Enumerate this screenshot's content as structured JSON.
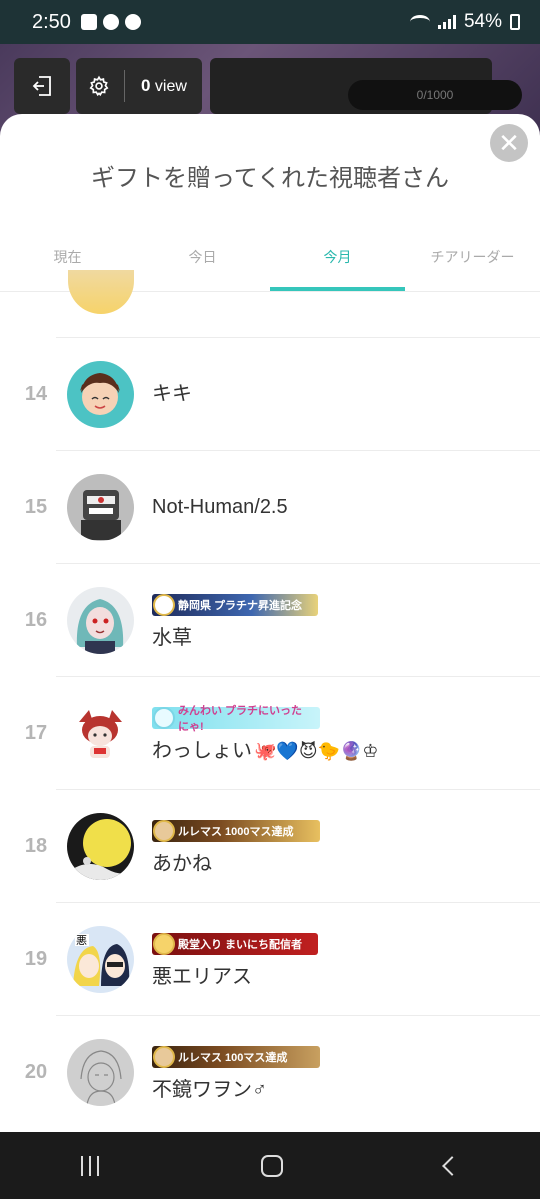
{
  "status_bar": {
    "time": "2:50",
    "battery": "54%"
  },
  "top_bar": {
    "views_count": "0",
    "views_unit": "view",
    "progress_text": "0/1000"
  },
  "sheet": {
    "title": "ギフトを贈ってくれた視聴者さん",
    "close_label": "✕"
  },
  "tabs": [
    {
      "label": "現在",
      "active": false
    },
    {
      "label": "今日",
      "active": false
    },
    {
      "label": "今月",
      "active": true
    },
    {
      "label": "チアリーダー",
      "active": false
    }
  ],
  "rows": [
    {
      "rank": "14",
      "name": "キキ"
    },
    {
      "rank": "15",
      "name": "Not-Human/2.5"
    },
    {
      "rank": "16",
      "name": "水草",
      "badge": "静岡県 プラチナ昇進記念"
    },
    {
      "rank": "17",
      "name": "わっしょい",
      "emojis": "🐙💙😈🐤🔮♔",
      "badge": "みんわい プラチにいったにゃ!"
    },
    {
      "rank": "18",
      "name": "あかね",
      "badge": "ルレマス 1000マス達成"
    },
    {
      "rank": "19",
      "name": "悪エリアス",
      "badge": "殿堂入り まいにち配信者"
    },
    {
      "rank": "20",
      "name": "不鏡ワヲン♂",
      "badge": "ルレマス 100マス達成"
    }
  ],
  "colors": {
    "accent": "#35c6bb",
    "rank_gray": "#b5b5b5"
  }
}
